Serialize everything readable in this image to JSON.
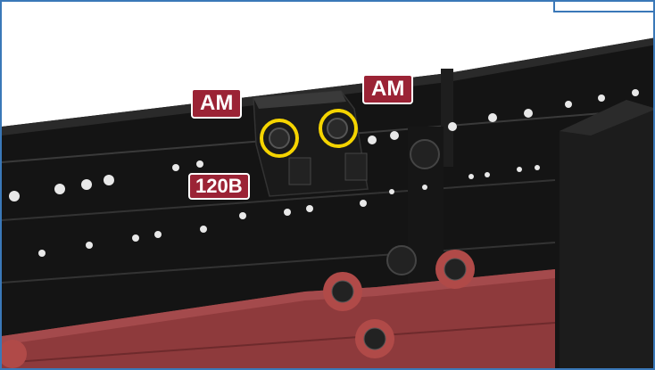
{
  "labels": {
    "am_left": "AM",
    "am_right": "AM",
    "screw": "120B"
  },
  "colors": {
    "label_bg": "#9b2335",
    "highlight": "#f5d400",
    "frame": "#3a78b8",
    "panel": "#8e3a3c",
    "rail": "#111111"
  },
  "highlights": [
    "screw-circle-left",
    "screw-circle-right"
  ]
}
